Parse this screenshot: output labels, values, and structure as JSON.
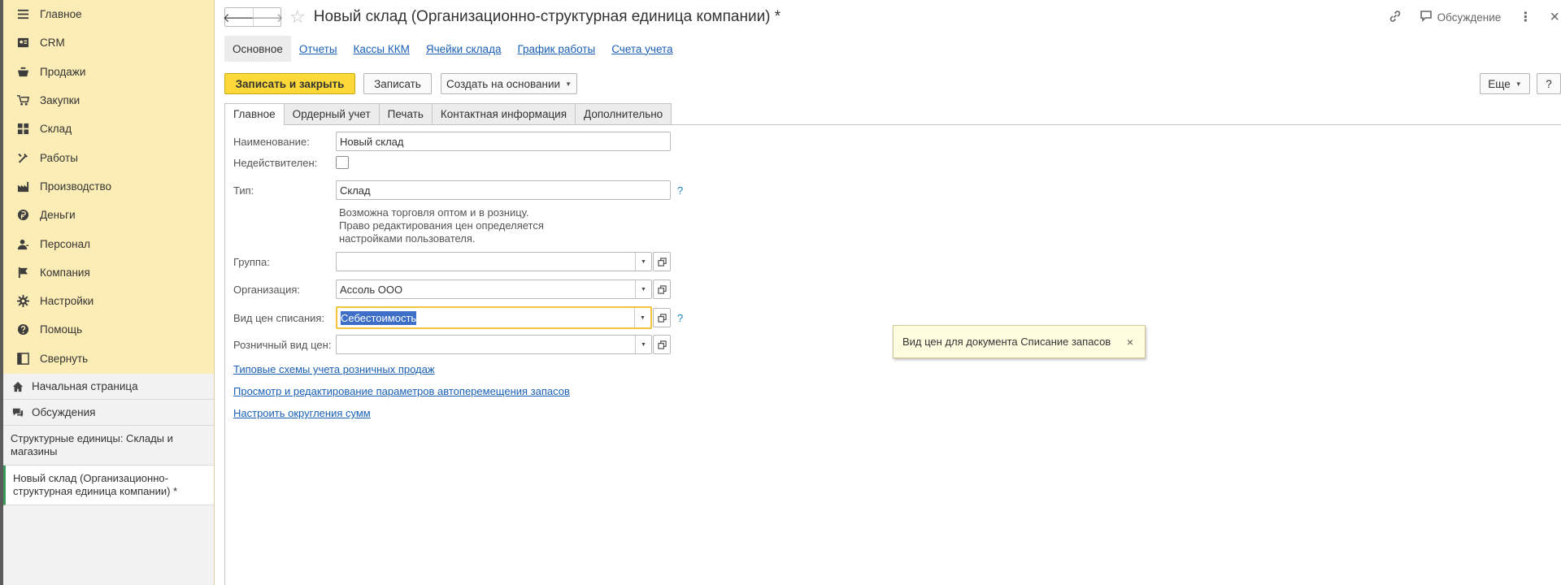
{
  "sidebar": {
    "items": [
      {
        "label": "Главное",
        "icon": "menu-icon"
      },
      {
        "label": "CRM",
        "icon": "contact-card-icon"
      },
      {
        "label": "Продажи",
        "icon": "basket-icon"
      },
      {
        "label": "Закупки",
        "icon": "cart-icon"
      },
      {
        "label": "Склад",
        "icon": "grid-icon"
      },
      {
        "label": "Работы",
        "icon": "tools-icon"
      },
      {
        "label": "Производство",
        "icon": "factory-icon"
      },
      {
        "label": "Деньги",
        "icon": "ruble-icon"
      },
      {
        "label": "Персонал",
        "icon": "person-icon"
      },
      {
        "label": "Компания",
        "icon": "flag-icon"
      },
      {
        "label": "Настройки",
        "icon": "gear-icon"
      },
      {
        "label": "Помощь",
        "icon": "help-icon"
      },
      {
        "label": "Свернуть",
        "icon": "collapse-icon"
      }
    ],
    "home_label": "Начальная страница",
    "discussions_label": "Обсуждения",
    "windows": [
      "Структурные единицы: Склады и магазины",
      "Новый склад (Организационно-структурная единица компании) *"
    ]
  },
  "header": {
    "back": "🡐",
    "forward": "🡒",
    "star": "☆",
    "title": "Новый склад (Организационно-структурная единица компании) *",
    "discussion_label": "Обсуждение",
    "more": "⋮",
    "close": "×"
  },
  "sections": [
    "Основное",
    "Отчеты",
    "Кассы ККМ",
    "Ячейки склада",
    "График работы",
    "Счета учета"
  ],
  "commands": {
    "save_close": "Записать и закрыть",
    "save": "Записать",
    "create_based": "Создать на основании",
    "more": "Еще",
    "help": "?"
  },
  "tabs": [
    "Главное",
    "Ордерный учет",
    "Печать",
    "Контактная информация",
    "Дополнительно"
  ],
  "form": {
    "name_label": "Наименование:",
    "name_value": "Новый склад",
    "inactive_label": "Недействителен:",
    "type_label": "Тип:",
    "type_value": "Склад",
    "type_note": [
      "Возможна торговля оптом и в розницу.",
      "Право редактирования цен определяется",
      "настройками пользователя."
    ],
    "group_label": "Группа:",
    "group_value": "",
    "org_label": "Организация:",
    "org_value": "Ассоль ООО",
    "writeoff_label": "Вид цен списания:",
    "writeoff_value": "Себестоимость",
    "retail_label": "Розничный вид цен:",
    "retail_value": "",
    "help_mark": "?",
    "dd_glyph": "▼"
  },
  "links": [
    "Типовые схемы учета розничных продаж",
    "Просмотр и редактирование параметров автоперемещения запасов",
    "Настроить округления сумм"
  ],
  "tooltip": {
    "text": "Вид цен для документа Списание запасов",
    "close": "×"
  }
}
